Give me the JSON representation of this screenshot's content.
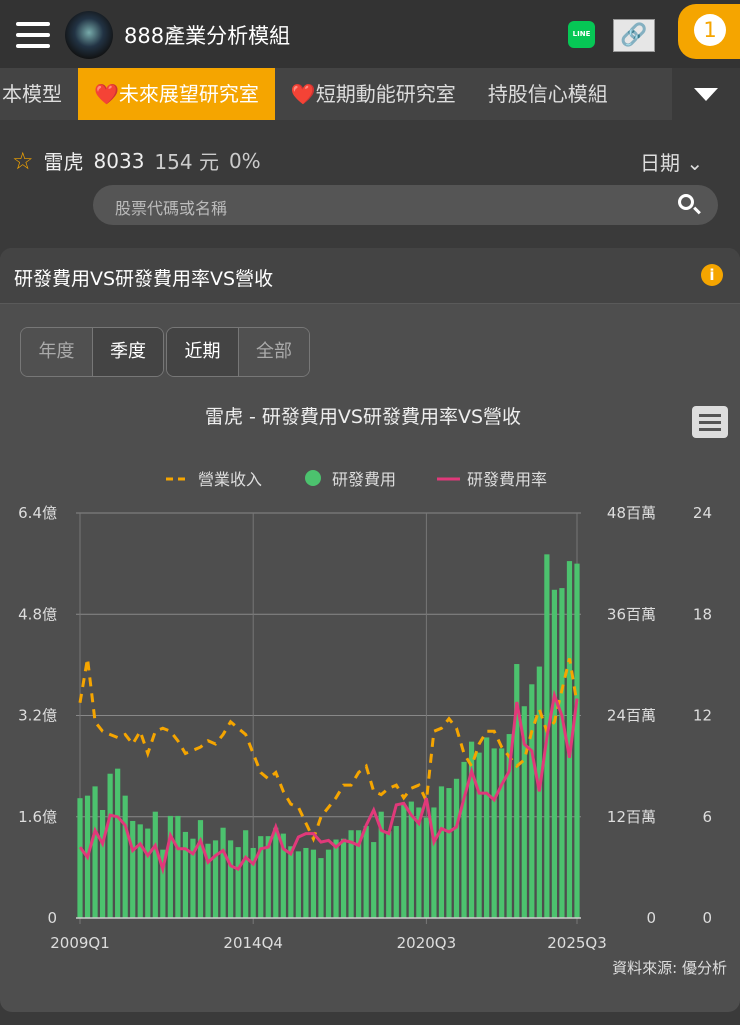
{
  "header": {
    "title": "888產業分析模組",
    "line_label": "LINE",
    "notification_count": "1"
  },
  "tabs": [
    {
      "label": "本模型"
    },
    {
      "label": "❤️未來展望研究室",
      "active": true
    },
    {
      "label": "❤️短期動能研究室"
    },
    {
      "label": "持股信心模組"
    }
  ],
  "stock": {
    "name": "雷虎",
    "code": "8033",
    "price": "154 元",
    "change": "0%",
    "date_label": "日期"
  },
  "search": {
    "placeholder": "股票代碼或名稱"
  },
  "card": {
    "title": "研發費用VS研發費用率VS營收",
    "period_buttons": [
      {
        "label": "年度"
      },
      {
        "label": "季度",
        "active": true
      }
    ],
    "range_buttons": [
      {
        "label": "近期",
        "active": true
      },
      {
        "label": "全部"
      }
    ]
  },
  "colors": {
    "accent": "#f5a500",
    "bars": "#4cc26e",
    "rate": "#e0397a"
  },
  "chart_data": {
    "type": "bar",
    "title": "雷虎 - 研發費用VS研發費用率VS營收",
    "legend": [
      "營業收入",
      "研發費用",
      "研發費用率"
    ],
    "legend_position": "top",
    "x_start": "2009Q1",
    "x_end": "2025Q3",
    "x_ticks": [
      "2009Q1",
      "2014Q4",
      "2020Q3",
      "2025Q3"
    ],
    "left_axis": {
      "ticks": [
        "0",
        "1.6億",
        "3.2億",
        "4.8億",
        "6.4億"
      ],
      "range": [
        0,
        6.4
      ],
      "unit": "億"
    },
    "mid_axis": {
      "ticks": [
        "0",
        "12百萬",
        "24百萬",
        "36百萬",
        "48百萬"
      ],
      "range": [
        0,
        48
      ],
      "unit": "百萬"
    },
    "right_axis": {
      "ticks": [
        "0",
        "6",
        "12",
        "18",
        "24"
      ],
      "range": [
        0,
        24
      ],
      "unit": "%"
    },
    "series": [
      {
        "name": "營業收入",
        "type": "dashed-line",
        "values": [
          3.4,
          4.1,
          3.1,
          2.95,
          2.9,
          2.85,
          2.9,
          2.75,
          2.95,
          2.6,
          2.95,
          3.0,
          2.95,
          2.8,
          2.6,
          2.65,
          2.7,
          2.8,
          2.75,
          2.9,
          3.1,
          3.0,
          2.9,
          2.6,
          2.3,
          2.2,
          2.3,
          2.0,
          1.8,
          1.75,
          1.5,
          1.25,
          1.6,
          1.75,
          1.9,
          2.1,
          2.1,
          2.3,
          2.4,
          2.0,
          1.95,
          2.05,
          2.1,
          1.9,
          2.05,
          2.1,
          1.85,
          2.95,
          3.0,
          3.15,
          3.0,
          2.6,
          2.4,
          2.75,
          2.95,
          2.95,
          2.7,
          2.55,
          2.4,
          2.5,
          2.95,
          3.3,
          2.95,
          3.1,
          3.6,
          4.1,
          3.4
        ]
      },
      {
        "name": "研發費用",
        "type": "bar",
        "values": [
          14.2,
          14.5,
          15.6,
          12.8,
          17.1,
          17.7,
          14.5,
          11.5,
          11.1,
          10.6,
          12.6,
          8.1,
          12.1,
          12.1,
          10.2,
          9.4,
          11.6,
          8.8,
          9.2,
          10.7,
          9.2,
          8.4,
          10.4,
          8.3,
          9.7,
          9.7,
          10.7,
          10.0,
          8.5,
          7.9,
          8.3,
          8.1,
          7.1,
          8.1,
          9.3,
          9.4,
          10.4,
          10.4,
          10.9,
          9.0,
          12.6,
          10.3,
          10.9,
          13.4,
          13.8,
          13.1,
          11.9,
          13.1,
          15.6,
          15.4,
          16.5,
          18.5,
          20.9,
          19.6,
          21.4,
          20.1,
          20.1,
          21.8,
          30.1,
          25.1,
          27.7,
          29.8,
          43.1,
          38.9,
          39.1,
          42.3,
          42.0
        ]
      },
      {
        "name": "研發費用率",
        "type": "line",
        "values": [
          4.2,
          3.6,
          5.2,
          4.4,
          6.1,
          6.0,
          5.5,
          4.0,
          4.4,
          3.7,
          4.3,
          2.9,
          4.9,
          4.1,
          4.1,
          3.8,
          4.6,
          3.3,
          3.7,
          4.0,
          3.1,
          2.9,
          3.6,
          3.2,
          4.1,
          4.2,
          5.4,
          4.1,
          3.8,
          4.8,
          5.0,
          5.0,
          4.5,
          4.6,
          4.2,
          4.6,
          4.5,
          4.3,
          5.5,
          6.4,
          5.2,
          5.0,
          6.7,
          6.8,
          6.1,
          5.6,
          7.1,
          4.5,
          5.3,
          5.1,
          5.4,
          7.1,
          8.7,
          7.4,
          7.4,
          7.0,
          7.9,
          8.7,
          12.8,
          10.3,
          9.9,
          7.5,
          10.7,
          13.2,
          12.0,
          9.5,
          13.0
        ]
      }
    ],
    "source": "資料來源: 優分析"
  }
}
